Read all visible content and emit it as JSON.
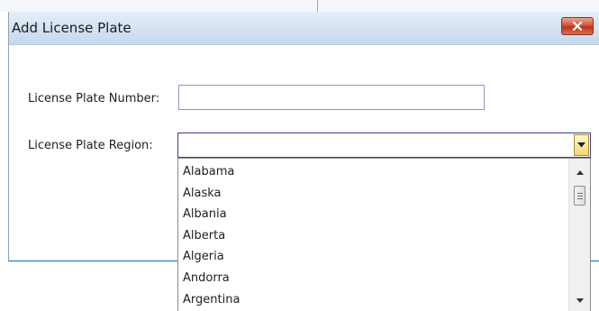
{
  "dialog": {
    "title": "Add License Plate"
  },
  "form": {
    "plate_number_label": "License Plate Number:",
    "plate_number_value": "",
    "plate_region_label": "License Plate Region:",
    "plate_region_value": ""
  },
  "dropdown": {
    "options": [
      "Alabama",
      "Alaska",
      "Albania",
      "Alberta",
      "Algeria",
      "Andorra",
      "Argentina"
    ]
  },
  "colors": {
    "close_button": "#c0321b",
    "combo_arrow": "#f7d86e",
    "title_bar": "#d3e2f2"
  }
}
